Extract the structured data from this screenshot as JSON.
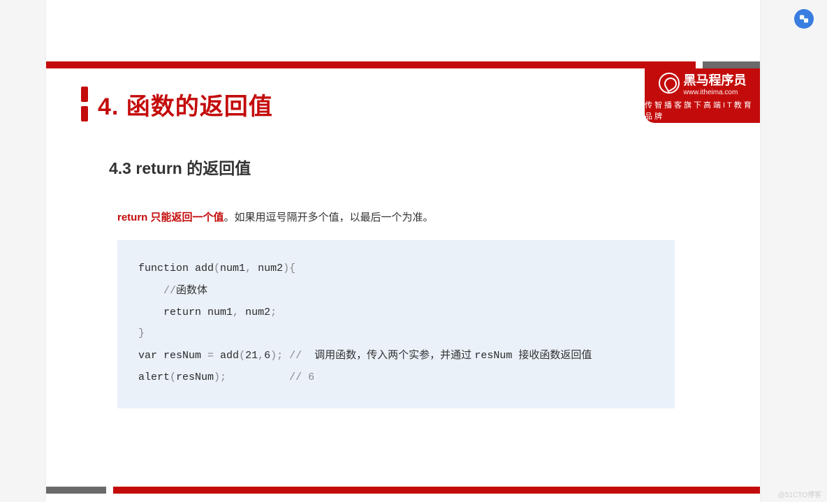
{
  "title": "4. 函数的返回值",
  "subtitle": "4.3 return 的返回值",
  "note": {
    "emph": "return 只能返回一个值",
    "rest": "。如果用逗号隔开多个值，以最后一个为准。"
  },
  "brand": {
    "name": "黑马程序员",
    "url": "www.itheima.com",
    "slogan": "传智播客旗下高端IT教育品牌"
  },
  "code": {
    "l1a": "function",
    "l1b": " add",
    "l1c": "(",
    "l1d": "num1",
    "l1e": ", ",
    "l1f": "num2",
    "l1g": "){",
    "l2a": "    //",
    "l2b": "函数体",
    "l3a": "    return num1",
    "l3b": ", ",
    "l3c": "num2",
    "l3d": ";",
    "l4a": "}",
    "l5a": "var resNum ",
    "l5b": "= ",
    "l5c": "add",
    "l5d": "(",
    "l5e": "21",
    "l5f": ",",
    "l5g": "6",
    "l5h": "); ",
    "l5i": "//  ",
    "l5j": "调用函数，传入两个实参，并通过 ",
    "l5k": "resNum ",
    "l5l": "接收函数返回值",
    "l6a": "alert",
    "l6b": "(",
    "l6c": "resNum",
    "l6d": ");",
    "l6e": "          // 6"
  },
  "watermark": "@51CTO博客"
}
